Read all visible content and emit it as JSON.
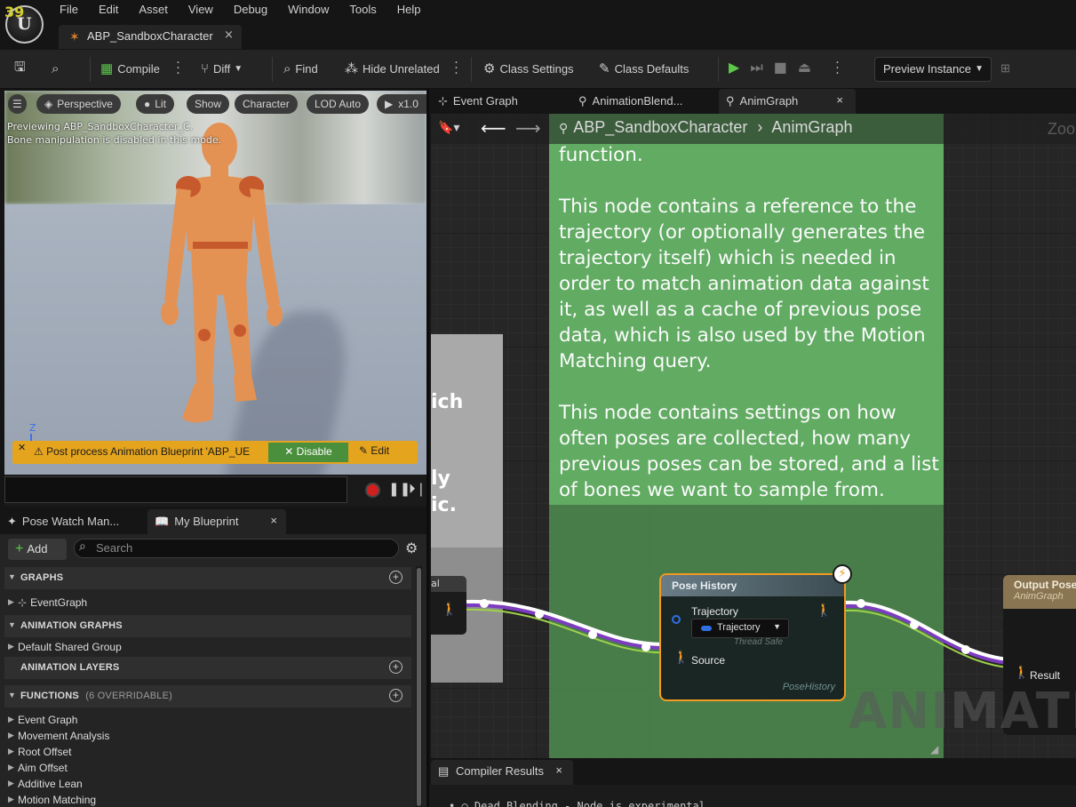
{
  "fps": "39",
  "menu": [
    "File",
    "Edit",
    "Asset",
    "View",
    "Debug",
    "Window",
    "Tools",
    "Help"
  ],
  "asset_tab": {
    "label": "ABP_SandboxCharacter",
    "close": "×"
  },
  "toolbar": {
    "compile": "Compile",
    "diff": "Diff",
    "find": "Find",
    "hide_unrelated": "Hide Unrelated",
    "class_settings": "Class Settings",
    "class_defaults": "Class Defaults",
    "preview_instance": "Preview Instance"
  },
  "viewport": {
    "perspective": "Perspective",
    "lit": "Lit",
    "show": "Show",
    "character": "Character",
    "lod": "LOD Auto",
    "speed": "x1.0",
    "info_line1": "Previewing ABP_SandboxCharacter_C.",
    "info_line2": "Bone manipulation is disabled in this mode.",
    "axis": "Z",
    "warning": "Post process Animation Blueprint 'ABP_UE",
    "disable": "Disable",
    "edit": "Edit"
  },
  "left_tabs": {
    "pose_watch": "Pose Watch Man...",
    "my_blueprint": "My Blueprint"
  },
  "my_blueprint": {
    "add": "Add",
    "search_placeholder": "Search",
    "graphs_header": "GRAPHS",
    "event_graph": "EventGraph",
    "anim_graphs_header": "ANIMATION GRAPHS",
    "default_shared_group": "Default Shared Group",
    "anim_layers_header": "ANIMATION LAYERS",
    "functions_header": "FUNCTIONS",
    "functions_overridable": "(6 OVERRIDABLE)",
    "functions": [
      "Event Graph",
      "Movement Analysis",
      "Root Offset",
      "Aim Offset",
      "Additive Lean",
      "Motion Matching"
    ]
  },
  "graph_tabs": {
    "event_graph": "Event Graph",
    "animation_blend": "AnimationBlend...",
    "anim_graph": "AnimGraph"
  },
  "breadcrumb": {
    "asset": "ABP_SandboxCharacter",
    "graph": "AnimGraph",
    "zoom": "Zoo"
  },
  "comment": {
    "top_line": "function.",
    "para1": "This node contains a reference to the trajectory (or optionally generates the trajectory itself) which is needed in order to match animation data against it, as well as a cache of previous pose data, which is also used by the Motion Matching query.",
    "para2": "This node contains settings on how often poses are collected, how many previous poses can be stored, and a list of bones we want to sample from."
  },
  "gray_comment": {
    "t1": "ich",
    "t2": "ly",
    "t3": "ic."
  },
  "left_node_title": "al",
  "pose_history": {
    "title": "Pose History",
    "trajectory_label": "Trajectory",
    "trajectory_value": "Trajectory",
    "thread_safe": "Thread Safe",
    "source": "Source",
    "footer": "PoseHistory"
  },
  "output_pose": {
    "title": "Output Pose",
    "subtitle": "AnimGraph",
    "result": "Result"
  },
  "watermark": "ANIMATIO",
  "compiler": {
    "tab": "Compiler Results",
    "line": "Dead Blending - Node is experimental"
  },
  "colors": {
    "accent_orange": "#f29a22",
    "comment_green": "#61ab63",
    "warning_yellow": "#e4a41e",
    "disable_green": "#4a8f3c"
  }
}
